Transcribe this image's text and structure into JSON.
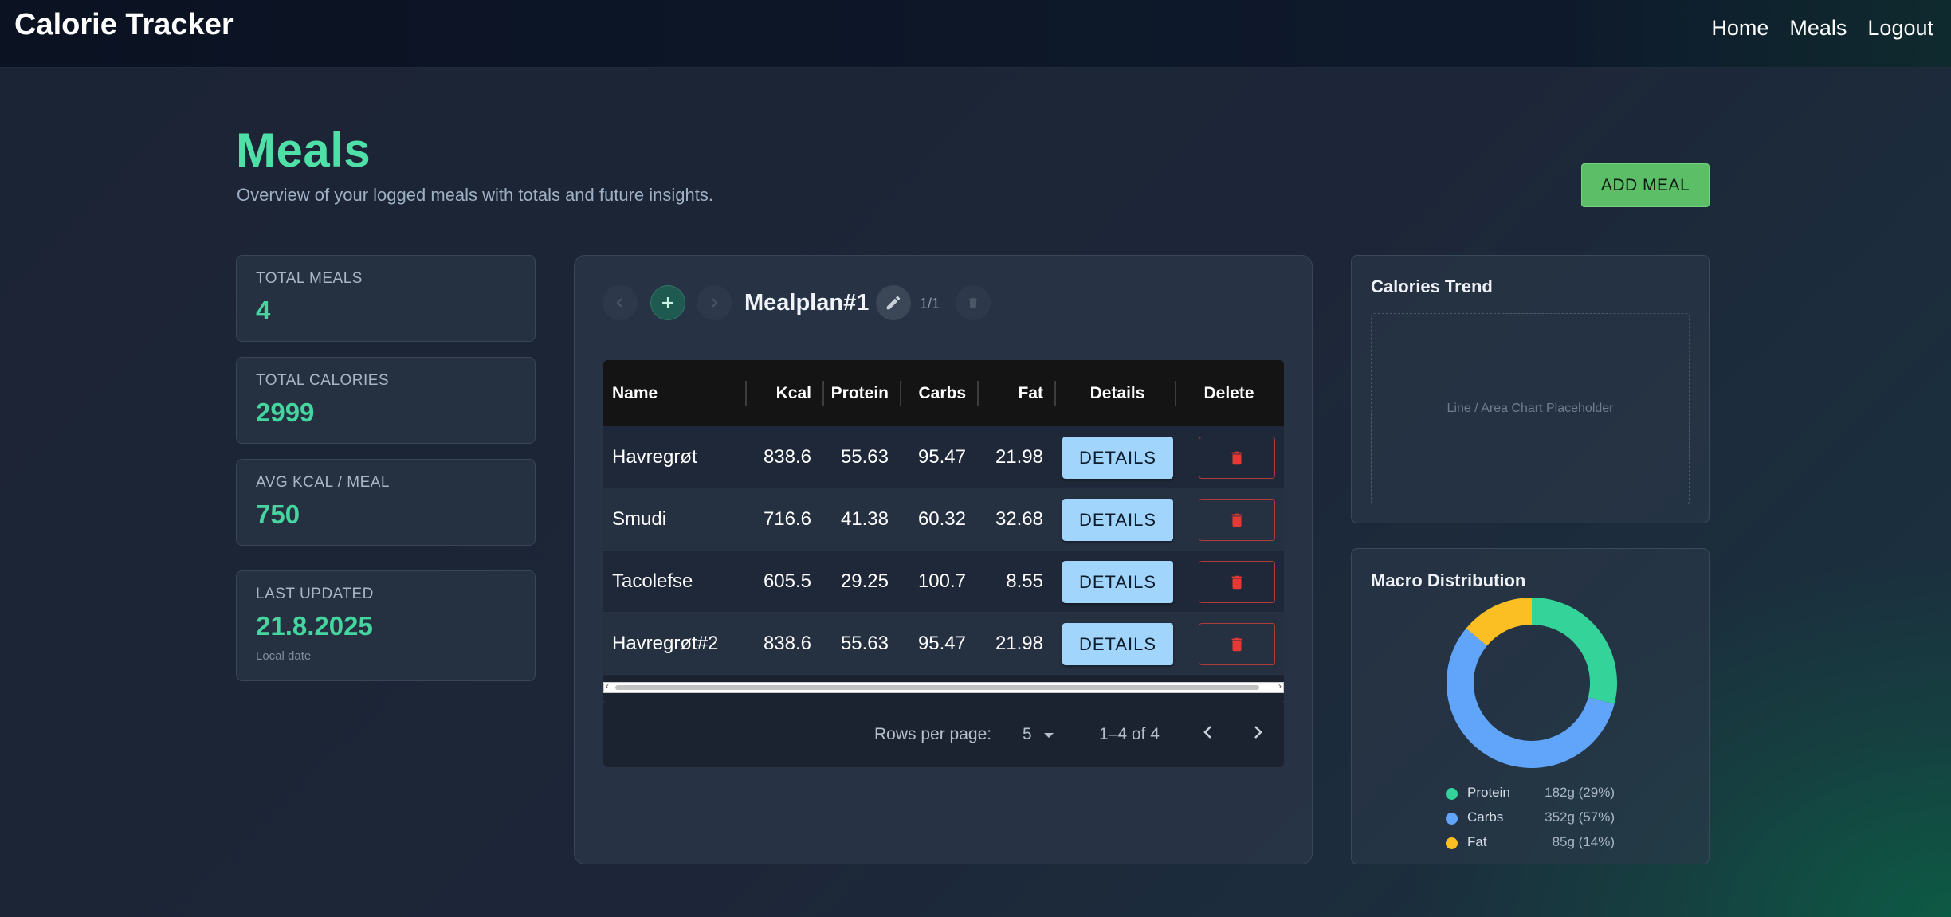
{
  "app": {
    "title": "Calorie Tracker"
  },
  "nav": {
    "home": "Home",
    "meals": "Meals",
    "logout": "Logout"
  },
  "header": {
    "title": "Meals",
    "subtitle": "Overview of your logged meals with totals and future insights.",
    "add_button": "ADD MEAL"
  },
  "stats": [
    {
      "label": "TOTAL MEALS",
      "value": "4"
    },
    {
      "label": "TOTAL CALORIES",
      "value": "2999"
    },
    {
      "label": "AVG KCAL / MEAL",
      "value": "750"
    },
    {
      "label": "LAST UPDATED",
      "value": "21.8.2025",
      "note": "Local date"
    }
  ],
  "mealplan": {
    "name": "Mealplan#1",
    "page": "1/1",
    "icons": {
      "prev": "chevron-left-icon",
      "add": "plus-icon",
      "next": "chevron-right-icon",
      "edit": "pencil-icon",
      "delete": "trash-icon"
    }
  },
  "table": {
    "columns": [
      "Name",
      "Kcal",
      "Protein",
      "Carbs",
      "Fat",
      "Details",
      "Delete"
    ],
    "details_label": "DETAILS",
    "rows": [
      {
        "name": "Havregrøt",
        "kcal": "838.6",
        "protein": "55.63",
        "carbs": "95.47",
        "fat": "21.98"
      },
      {
        "name": "Smudi",
        "kcal": "716.6",
        "protein": "41.38",
        "carbs": "60.32",
        "fat": "32.68"
      },
      {
        "name": "Tacolefse",
        "kcal": "605.5",
        "protein": "29.25",
        "carbs": "100.7",
        "fat": "8.55"
      },
      {
        "name": "Havregrøt#2",
        "kcal": "838.6",
        "protein": "55.63",
        "carbs": "95.47",
        "fat": "21.98"
      }
    ]
  },
  "pagination": {
    "rows_per_page_label": "Rows per page:",
    "rows_per_page": "5",
    "range": "1–4 of 4"
  },
  "calories_trend": {
    "title": "Calories Trend",
    "placeholder": "Line / Area Chart Placeholder"
  },
  "macros": {
    "title": "Macro Distribution",
    "items": [
      {
        "name": "Protein",
        "value": "182g (29%)",
        "percent": 29,
        "color": "#34d399"
      },
      {
        "name": "Carbs",
        "value": "352g (57%)",
        "percent": 57,
        "color": "#60a5fa"
      },
      {
        "name": "Fat",
        "value": "85g (14%)",
        "percent": 14,
        "color": "#fbbf24"
      }
    ]
  },
  "colors": {
    "accent": "#4fe0a8",
    "add_button": "#5cbf68",
    "details_button": "#a1d5fb",
    "delete_icon": "#e53935"
  }
}
